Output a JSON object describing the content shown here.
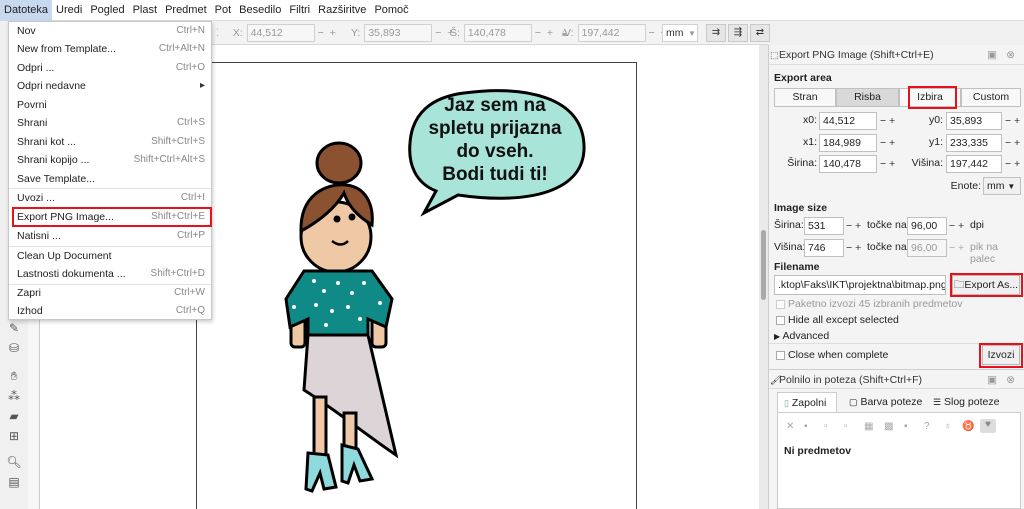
{
  "menubar": {
    "items": [
      "Datoteka",
      "Uredi",
      "Pogled",
      "Plast",
      "Predmet",
      "Pot",
      "Besedilo",
      "Filtri",
      "Razširitve",
      "Pomoč"
    ]
  },
  "toolbar": {
    "x_label": "X:",
    "x_value": "44,512",
    "y_label": "Y:",
    "y_value": "35,893",
    "w_label": "Š:",
    "w_value": "140,478",
    "h_label": "V:",
    "h_value": "197,442",
    "unit": "mm"
  },
  "file_menu": {
    "items": [
      {
        "label": "Nov",
        "shortcut": "Ctrl+N"
      },
      {
        "label": "New from Template...",
        "shortcut": "Ctrl+Alt+N"
      },
      {
        "label": "Odpri ...",
        "shortcut": "Ctrl+O"
      },
      {
        "label": "Odpri nedavne",
        "shortcut": "▸"
      },
      {
        "label": "Povrni",
        "shortcut": ""
      },
      {
        "label": "Shrani",
        "shortcut": "Ctrl+S"
      },
      {
        "label": "Shrani kot ...",
        "shortcut": "Shift+Ctrl+S"
      },
      {
        "label": "Shrani kopijo ...",
        "shortcut": "Shift+Ctrl+Alt+S"
      },
      {
        "label": "Save Template...",
        "shortcut": ""
      },
      {
        "label": "Uvozi ...",
        "shortcut": "Ctrl+I"
      },
      {
        "label": "Export PNG Image...",
        "shortcut": "Shift+Ctrl+E"
      },
      {
        "label": "Natisni ...",
        "shortcut": "Ctrl+P"
      },
      {
        "label": "Clean Up Document",
        "shortcut": ""
      },
      {
        "label": "Lastnosti dokumenta ...",
        "shortcut": "Shift+Ctrl+D"
      },
      {
        "label": "Zapri",
        "shortcut": "Ctrl+W"
      },
      {
        "label": "Izhod",
        "shortcut": "Ctrl+Q"
      }
    ]
  },
  "canvas": {
    "speech": [
      "Jaz sem na",
      "spletu prijazna",
      "do vseh.",
      "Bodi tudi ti!"
    ]
  },
  "export_panel": {
    "title": "Export PNG Image (Shift+Ctrl+E)",
    "area_heading": "Export area",
    "area_buttons": [
      "Stran",
      "Risba",
      "Izbira",
      "Custom"
    ],
    "x0_label": "x0:",
    "x0": "44,512",
    "y0_label": "y0:",
    "y0": "35,893",
    "x1_label": "x1:",
    "x1": "184,989",
    "y1_label": "y1:",
    "y1": "233,335",
    "width_label": "Širina:",
    "width": "140,478",
    "height_label": "Višina:",
    "height": "197,442",
    "units_label": "Enote:",
    "units": "mm",
    "size_heading": "Image size",
    "px_width_label": "Širina:",
    "px_width": "531",
    "px_height_label": "Višina:",
    "px_height": "746",
    "dots_at": "točke na",
    "dpi": "96,00",
    "dpi_unit": "dpi",
    "dpi2": "96,00",
    "dpi2_unit": "pik na palec",
    "filename_heading": "Filename",
    "filename": ".ktop\\Faks\\IKT\\projektna\\bitmap.png",
    "export_as": "Export As...",
    "batch": "Paketno izvozi 45 izbranih predmetov",
    "hide_all": "Hide all except selected",
    "advanced": "Advanced",
    "close_when": "Close when complete",
    "export": "Izvozi"
  },
  "fill_panel": {
    "title": "Polnilo in poteza (Shift+Ctrl+F)",
    "tabs": [
      "Zapolni",
      "Barva poteze",
      "Slog poteze"
    ],
    "status": "Ni predmetov"
  }
}
